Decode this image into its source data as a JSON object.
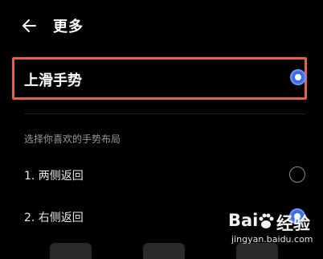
{
  "header": {
    "back_icon": "arrow-left-icon",
    "title": "更多"
  },
  "selected_option": {
    "label": "上滑手势",
    "selected": true
  },
  "section_title": "选择你喜欢的手势布局",
  "options": [
    {
      "label": "1. 两侧返回",
      "selected": false
    },
    {
      "label": "2. 右侧返回",
      "selected": true
    }
  ],
  "watermark": {
    "logo_left": "Bai",
    "logo_right": "经验",
    "url": "jingyan.baidu.com"
  },
  "colors": {
    "accent": "#3d6fe0",
    "highlight_border": "#e2614f",
    "background": "#000000"
  }
}
